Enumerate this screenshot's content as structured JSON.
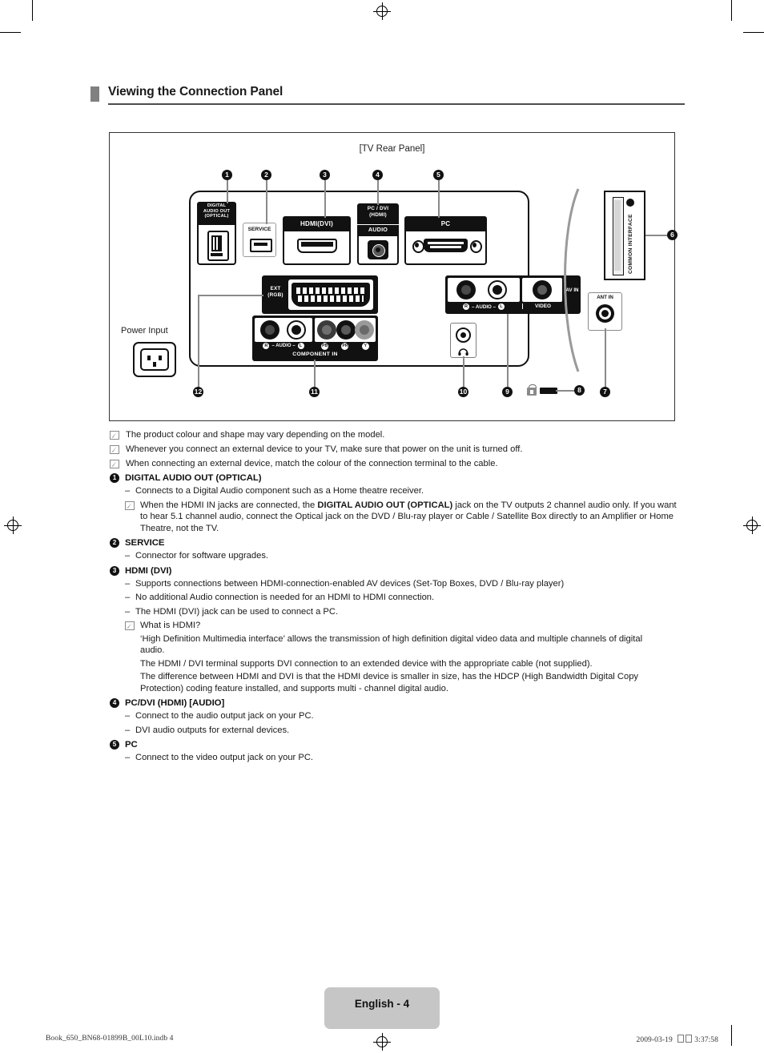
{
  "heading": {
    "title": "Viewing the Connection Panel"
  },
  "figure": {
    "caption": "[TV Rear Panel]",
    "power_input_label": "Power Input",
    "jacks": {
      "digital_audio_out": "DIGITAL\nAUDIO OUT\n(OPTICAL)",
      "digital_audio_out_l1": "DIGITAL",
      "digital_audio_out_l2": "AUDIO OUT",
      "digital_audio_out_l3": "(OPTICAL)",
      "service": "SERVICE",
      "hdmi_dvi": "HDMI(DVI)",
      "pcdvi_l1": "PC / DVI",
      "pcdvi_l2": "(HDMI)",
      "pcdvi_audio": "AUDIO",
      "pc": "PC",
      "ext_l1": "EXT",
      "ext_l2": "(RGB)",
      "audio_r": "R",
      "audio_dash_left": "– AUDIO –",
      "audio_l": "L",
      "component_in": "COMPONENT IN",
      "comp_pb": "PB",
      "comp_pr": "PR",
      "comp_y": "Y",
      "av_audio_r": "R",
      "av_audio_mid": "– AUDIO –",
      "av_audio_l": "L",
      "video": "VIDEO",
      "av_in": "AV IN",
      "ant_in": "ANT IN",
      "common_interface": "COMMON INTERFACE"
    },
    "callouts": [
      "1",
      "2",
      "3",
      "4",
      "5",
      "6",
      "7",
      "8",
      "9",
      "10",
      "11",
      "12"
    ]
  },
  "notes": [
    "The product colour and shape may vary depending on the model.",
    "Whenever you connect an external device to your TV, make sure that power on the unit is turned off.",
    "When connecting an external device, match the colour of the connection terminal to the cable."
  ],
  "items": [
    {
      "num": "1",
      "title": "DIGITAL AUDIO OUT (OPTICAL)",
      "dashes": [
        "Connects to a Digital Audio component such as a Home theatre receiver."
      ],
      "note_rich_pre": "When the HDMI IN jacks are connected, the ",
      "note_rich_bold": "DIGITAL AUDIO OUT (OPTICAL)",
      "note_rich_post": " jack on the TV outputs 2 channel audio only. If you want to hear 5.1 channel audio, connect the Optical jack on the DVD / Blu-ray player or Cable / Satellite Box directly to an Amplifier or Home Theatre, not the TV."
    },
    {
      "num": "2",
      "title": "SERVICE",
      "dashes": [
        "Connector for software upgrades."
      ]
    },
    {
      "num": "3",
      "title": "HDMI (DVI)",
      "dashes": [
        "Supports connections between HDMI-connection-enabled AV devices (Set-Top Boxes, DVD / Blu-ray player)",
        "No additional Audio connection is needed for an HDMI to HDMI connection.",
        "The HDMI (DVI) jack can be used to connect a PC."
      ],
      "note_title": "What is HDMI?",
      "paragraphs": [
        "‘High Definition Multimedia interface’ allows the transmission of high definition digital video data and multiple channels of digital audio.",
        "The HDMI / DVI terminal supports DVI connection to an extended device with the appropriate cable (not supplied).",
        "The difference between HDMI and DVI is that the HDMI device is smaller in size, has the HDCP (High Bandwidth Digital Copy Protection) coding feature installed, and supports multi - channel digital audio."
      ]
    },
    {
      "num": "4",
      "title": "PC/DVI (HDMI) [AUDIO]",
      "dashes": [
        "Connect to the audio output jack on your PC.",
        "DVI audio outputs for external devices."
      ]
    },
    {
      "num": "5",
      "title": "PC",
      "dashes": [
        "Connect to the video output jack on your PC."
      ]
    }
  ],
  "footer": {
    "page_label": "English - 4",
    "file_ref": "Book_650_BN68-01899B_00L10.indb   4",
    "timestamp_date": "2009-03-19",
    "timestamp_time": "3:37:58"
  }
}
